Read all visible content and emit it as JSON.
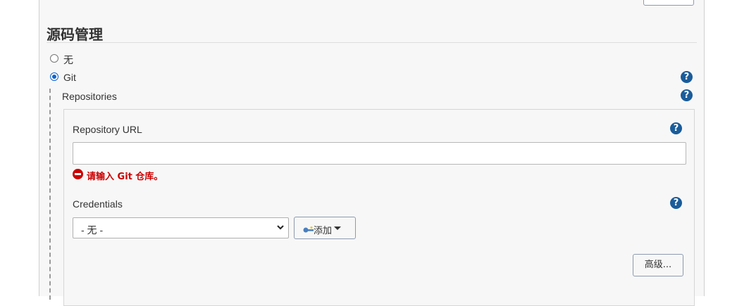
{
  "scm": {
    "title": "源码管理",
    "options": [
      {
        "label": "无",
        "selected": false
      },
      {
        "label": "Git",
        "selected": true
      }
    ]
  },
  "repositories": {
    "label": "Repositories",
    "url_label": "Repository URL",
    "url_value": "",
    "error_message": "请输入 Git 仓库。",
    "credentials_label": "Credentials",
    "credentials_selected": "- 无 -",
    "add_button_label": "添加",
    "advanced_button_label": "高级..."
  },
  "help_icon_glyph": "?",
  "icons": {
    "help": "help-icon",
    "error": "error-icon",
    "key": "key-icon",
    "caret": "caret-down-icon"
  },
  "colors": {
    "help": "#1a5c9a",
    "error": "#cc0000",
    "radio_checked": "#0b63d1"
  }
}
